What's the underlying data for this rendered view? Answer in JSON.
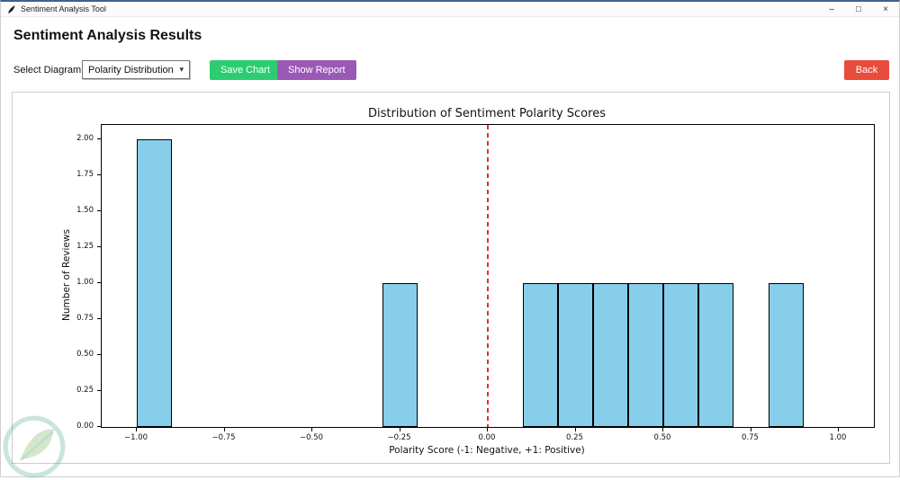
{
  "window": {
    "title": "Sentiment Analysis Tool"
  },
  "icons": {
    "minimize": "–",
    "maximize": "□",
    "close": "×",
    "dropdown_arrow": "▾"
  },
  "header": {
    "title": "Sentiment Analysis Results"
  },
  "toolbar": {
    "select_label": "Select Diagram:",
    "dropdown_value": "Polarity Distribution",
    "save_label": "Save Chart",
    "report_label": "Show Report",
    "back_label": "Back"
  },
  "colors": {
    "save_button": "#2ecc71",
    "report_button": "#9b59b6",
    "back_button": "#e74c3c",
    "bar_fill": "#87ceeb",
    "bar_edge": "#000000",
    "zero_line": "#e03131",
    "window_accent": "#41618a"
  },
  "chart_data": {
    "type": "bar",
    "title": "Distribution of Sentiment Polarity Scores",
    "xlabel": "Polarity Score (-1: Negative, +1: Positive)",
    "ylabel": "Number of Reviews",
    "xlim": [
      -1.1,
      1.1
    ],
    "ylim": [
      0,
      2.1
    ],
    "grid": false,
    "legend": false,
    "bin_width": 0.1,
    "x_ticks": [
      -1.0,
      -0.75,
      -0.5,
      -0.25,
      0,
      0.25,
      0.5,
      0.75,
      1.0
    ],
    "x_tick_labels": [
      "−1.00",
      "−0.75",
      "−0.50",
      "−0.25",
      "0.00",
      "0.25",
      "0.50",
      "0.75",
      "1.00"
    ],
    "y_ticks": [
      0,
      0.25,
      0.5,
      0.75,
      1.0,
      1.25,
      1.5,
      1.75,
      2.0
    ],
    "y_tick_labels": [
      "0.00",
      "0.25",
      "0.50",
      "0.75",
      "1.00",
      "1.25",
      "1.50",
      "1.75",
      "2.00"
    ],
    "bars": [
      {
        "x0": -1.0,
        "x1": -0.9,
        "count": 2
      },
      {
        "x0": -0.3,
        "x1": -0.2,
        "count": 1
      },
      {
        "x0": 0.1,
        "x1": 0.2,
        "count": 1
      },
      {
        "x0": 0.2,
        "x1": 0.3,
        "count": 1
      },
      {
        "x0": 0.3,
        "x1": 0.4,
        "count": 1
      },
      {
        "x0": 0.4,
        "x1": 0.5,
        "count": 1
      },
      {
        "x0": 0.5,
        "x1": 0.6,
        "count": 1
      },
      {
        "x0": 0.6,
        "x1": 0.7,
        "count": 1
      },
      {
        "x0": 0.8,
        "x1": 0.9,
        "count": 1
      }
    ],
    "zero_line_x": 0
  }
}
